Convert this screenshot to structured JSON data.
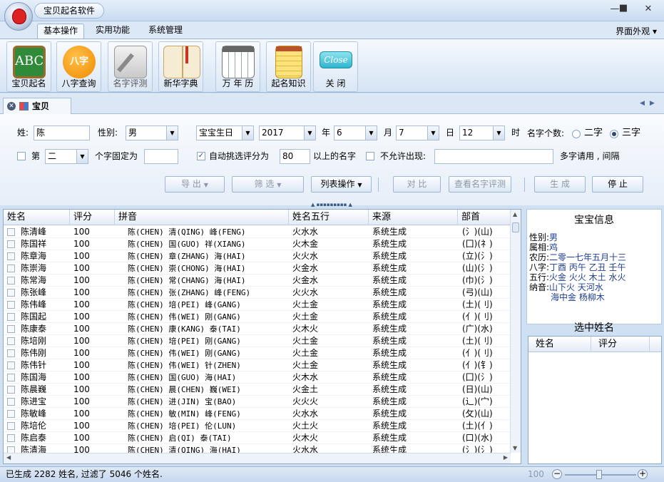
{
  "app": {
    "title": "宝贝起名软件"
  },
  "menu": {
    "tabs": [
      "基本操作",
      "实用功能",
      "系统管理"
    ],
    "skin": "界面外观"
  },
  "ribbon": {
    "buttons": [
      {
        "label": "宝贝起名",
        "icon": "abc-board-icon"
      },
      {
        "label": "八字查询",
        "icon": "bazi-icon",
        "icon_text": "八字"
      },
      {
        "label": "名字评测",
        "icon": "evaluate-icon"
      },
      {
        "label": "新华字典",
        "icon": "dictionary-icon"
      },
      {
        "label": "万 年 历",
        "icon": "calendar-icon"
      },
      {
        "label": "起名知识",
        "icon": "notepad-icon"
      },
      {
        "label": "关   闭",
        "icon": "close-sign-icon",
        "icon_text": "Close"
      }
    ]
  },
  "doc_tab": {
    "label": "宝贝"
  },
  "form": {
    "surname_label": "姓:",
    "surname": "陈",
    "gender_label": "性别:",
    "gender": "男",
    "birth_type": "宝宝生日",
    "year": "2017",
    "year_label": "年",
    "month": "6",
    "month_label": "月",
    "day": "7",
    "day_label": "日",
    "hour": "12",
    "hour_label": "时",
    "count_label": "名字个数:",
    "two_char": "二字",
    "three_char": "三字",
    "fix_label": "第",
    "fix_pos": "二",
    "fix_suffix": "个字固定为",
    "fix_value": "",
    "auto_label": "自动挑选评分为",
    "auto_score": "80",
    "auto_suffix": "以上的名字",
    "disallow_label": "不允许出现:",
    "disallow_value": "",
    "disallow_hint": "多字请用 , 间隔"
  },
  "actions": {
    "export": "导  出",
    "filter": "筛  选",
    "list_ops": "列表操作",
    "compare": "对  比",
    "view_eval": "查看名字评测",
    "generate": "生  成",
    "stop": "停 止"
  },
  "table": {
    "headers": [
      "姓名",
      "评分",
      "拼音",
      "姓名五行",
      "来源",
      "部首"
    ],
    "rows": [
      [
        "陈清峰",
        "100",
        "陈(CHEN)  清(QING)  峰(FENG)",
        "火水水",
        "系统生成",
        "(氵)(山)"
      ],
      [
        "陈国祥",
        "100",
        "陈(CHEN)  国(GUO)  祥(XIANG)",
        "火木金",
        "系统生成",
        "(囗)(礻)"
      ],
      [
        "陈章海",
        "100",
        "陈(CHEN)  章(ZHANG)  海(HAI)",
        "火火水",
        "系统生成",
        "(立)(氵)"
      ],
      [
        "陈崇海",
        "100",
        "陈(CHEN)  崇(CHONG)  海(HAI)",
        "火金水",
        "系统生成",
        "(山)(氵)"
      ],
      [
        "陈常海",
        "100",
        "陈(CHEN)  常(CHANG)  海(HAI)",
        "火金水",
        "系统生成",
        "(巾)(氵)"
      ],
      [
        "陈张峰",
        "100",
        "陈(CHEN)  张(ZHANG)  峰(FENG)",
        "火火水",
        "系统生成",
        "(弓)(山)"
      ],
      [
        "陈伟峰",
        "100",
        "陈(CHEN)  培(PEI)  峰(GANG)",
        "火土金",
        "系统生成",
        "(土)(刂)"
      ],
      [
        "陈国起",
        "100",
        "陈(CHEN)  伟(WEI)  刚(GANG)",
        "火土金",
        "系统生成",
        "(亻)(刂)"
      ],
      [
        "陈康泰",
        "100",
        "陈(CHEN)  康(KANG)  泰(TAI)",
        "火木火",
        "系统生成",
        "(广)(水)"
      ],
      [
        "陈培刚",
        "100",
        "陈(CHEN)  培(PEI)  刚(GANG)",
        "火土金",
        "系统生成",
        "(土)(刂)"
      ],
      [
        "陈伟刚",
        "100",
        "陈(CHEN)  伟(WEI)  刚(GANG)",
        "火土金",
        "系统生成",
        "(亻)(刂)"
      ],
      [
        "陈伟针",
        "100",
        "陈(CHEN)  伟(WEI)  针(ZHEN)",
        "火土金",
        "系统生成",
        "(亻)(钅)"
      ],
      [
        "陈国海",
        "100",
        "陈(CHEN)  国(GUO)  海(HAI)",
        "火木水",
        "系统生成",
        "(囗)(氵)"
      ],
      [
        "陈晨巍",
        "100",
        "陈(CHEN)  晨(CHEN)  巍(WEI)",
        "火金土",
        "系统生成",
        "(日)(山)"
      ],
      [
        "陈进宝",
        "100",
        "陈(CHEN)  进(JIN)  宝(BAO)",
        "火火火",
        "系统生成",
        "(辶)(宀)"
      ],
      [
        "陈敏峰",
        "100",
        "陈(CHEN)  敏(MIN)  峰(FENG)",
        "火水水",
        "系统生成",
        "(攵)(山)"
      ],
      [
        "陈培伦",
        "100",
        "陈(CHEN)  培(PEI)  伦(LUN)",
        "火土火",
        "系统生成",
        "(土)(亻)"
      ],
      [
        "陈启泰",
        "100",
        "陈(CHEN)  启(QI)  泰(TAI)",
        "火木火",
        "系统生成",
        "(口)(水)"
      ],
      [
        "陈清海",
        "100",
        "陈(CHEN)  清(QING)  海(HAI)",
        "火水水",
        "系统生成",
        "(氵)(氵)"
      ]
    ]
  },
  "info": {
    "title": "宝宝信息",
    "gender_label": "性别:",
    "gender": "男",
    "zodiac_label": "属相:",
    "zodiac": "鸡",
    "lunar_label": "农历:",
    "lunar": "二零一七年五月十三",
    "bazi_label": "八字:",
    "bazi": "丁酉  丙午  乙丑  壬午",
    "wuxing_label": "五行:",
    "wuxing": "火金  火火  木土  水火",
    "nayin_label": "纳音:",
    "nayin1": "山下火  天河水",
    "nayin2": "海中金  杨柳木"
  },
  "selected": {
    "title": "选中姓名",
    "headers": [
      "姓名",
      "评分"
    ]
  },
  "status": {
    "text": "已生成 2282 姓名, 过滤了 5046 个姓名.",
    "zoom": "100"
  }
}
